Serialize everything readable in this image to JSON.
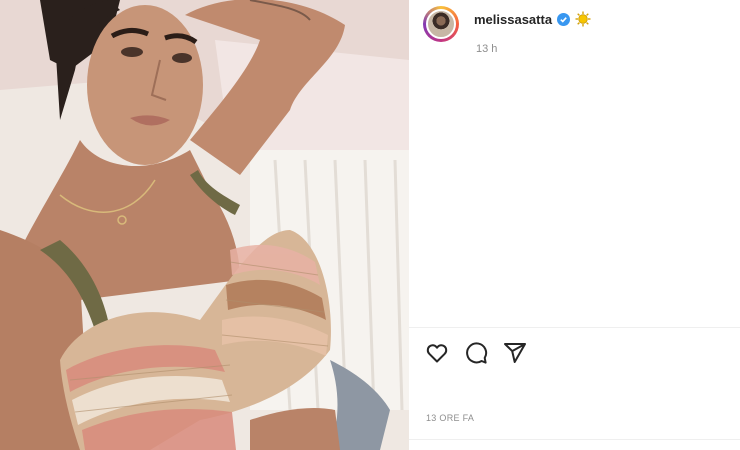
{
  "post": {
    "image_alt": "selfie photo",
    "username": "melissasatta",
    "verified_icon": "verified-badge-icon",
    "badge_icon": "sun-emoji-icon",
    "time_short": "13 h",
    "time_long": "13 ORE FA"
  },
  "actions": [
    {
      "name": "like-button",
      "icon": "heart-icon"
    },
    {
      "name": "comment-button",
      "icon": "comment-icon"
    },
    {
      "name": "share-button",
      "icon": "paper-plane-icon"
    }
  ],
  "colors": {
    "text": "#262626",
    "muted": "#8e8e8e",
    "verified": "#3897f0",
    "divider": "#efefef"
  }
}
